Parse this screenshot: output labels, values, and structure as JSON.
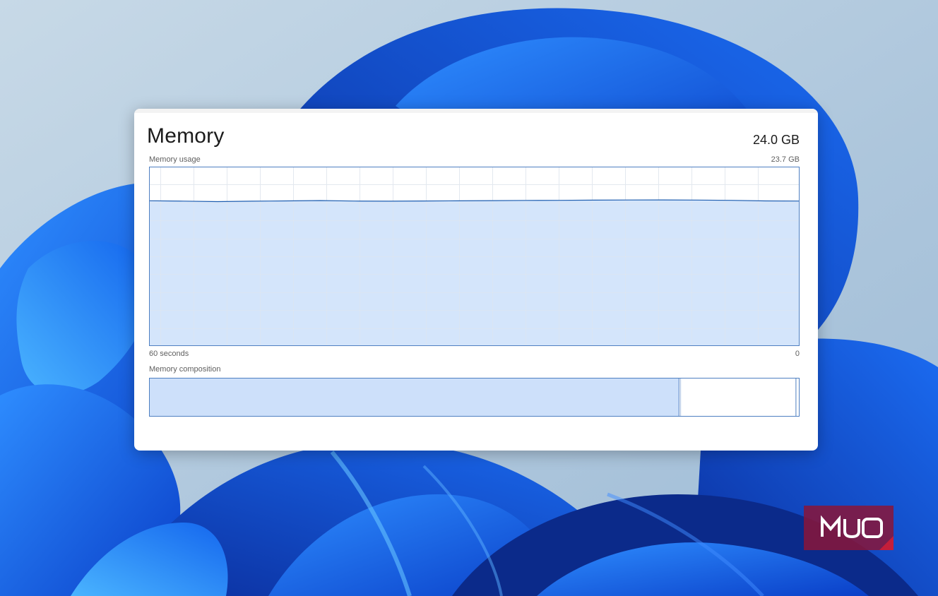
{
  "window": {
    "title": "Memory",
    "total_memory": "24.0 GB"
  },
  "memory_usage": {
    "label": "Memory usage",
    "max_label": "23.7 GB",
    "axis_left_label": "60 seconds",
    "axis_right_label": "0",
    "usage_fraction_of_max": 0.81
  },
  "memory_composition": {
    "label": "Memory composition",
    "in_use_fraction": 0.815,
    "modified_fraction": 0.003,
    "standby_fraction": 0.177,
    "free_fraction": 0.005
  },
  "watermark": {
    "text": "MUO"
  },
  "colors": {
    "graph_border": "#4e7fc1",
    "graph_fill": "#cde0fa",
    "graph_line": "#1f5eb0",
    "grid": "#e3e8ef",
    "logo_bg": "#8a1538"
  }
}
